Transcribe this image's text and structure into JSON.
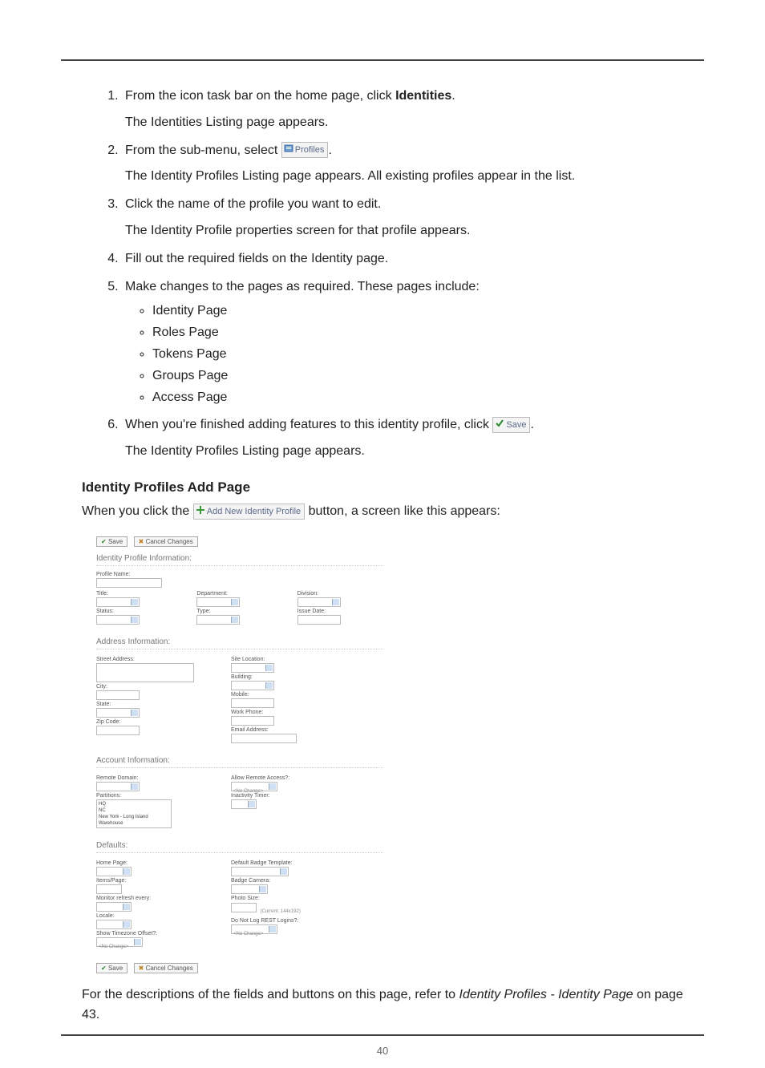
{
  "page_number": "40",
  "steps": {
    "s1a": "From the icon task bar on the home page, click ",
    "s1bold": "Identities",
    "s1b": ".",
    "s1sub": "The Identities Listing page appears.",
    "s2a": "From the sub-menu, select ",
    "s2btn_label": "Profiles",
    "s2b": ".",
    "s2sub": "The Identity Profiles Listing page appears. All existing profiles appear in the list.",
    "s3": "Click the name of the profile you want to edit.",
    "s3sub": "The Identity Profile properties screen for that profile appears.",
    "s4": "Fill out the required fields on the Identity page.",
    "s5": "Make changes to the pages as required. These pages include:",
    "bullets": {
      "b1": "Identity Page",
      "b2": "Roles Page",
      "b3": "Tokens Page",
      "b4": "Groups Page",
      "b5": "Access Page"
    },
    "s6a": "When you're finished adding features to this identity profile, click ",
    "s6btn_label": "Save",
    "s6b": ".",
    "s6sub": "The Identity Profiles Listing page appears."
  },
  "heading2": "Identity Profiles Add Page",
  "intro2a": "When you click the ",
  "intro2btn": "Add New Identity Profile",
  "intro2b": " button, a screen like this appears:",
  "fig": {
    "toolbar_save": "Save",
    "toolbar_cancel": "Cancel Changes",
    "sec_profile": "Identity Profile Information:",
    "profile_name": "Profile Name:",
    "title": "Title:",
    "department": "Department:",
    "division": "Division:",
    "status": "Status:",
    "type": "Type:",
    "issue_date": "Issue Date:",
    "sec_address": "Address Information:",
    "street": "Street Address:",
    "city": "City:",
    "state": "State:",
    "zip": "Zip Code:",
    "site_location": "Site Location:",
    "building": "Building:",
    "mobile": "Mobile:",
    "work_phone": "Work Phone:",
    "email": "Email Address:",
    "sec_account": "Account Information:",
    "remote_domain": "Remote Domain:",
    "partitions": "Partitions:",
    "part_opt1": "HQ",
    "part_opt2": "NC",
    "part_opt3": "New York - Long Island Warehouse",
    "allow_remote": "Allow Remote Access?:",
    "no_change": "<No Change>",
    "inactivity_timer": "Inactivity Timer:",
    "sec_defaults": "Defaults:",
    "home_page": "Home Page:",
    "items_page": "Items/Page:",
    "monitor_refresh": "Monitor refresh every:",
    "locale": "Locale:",
    "show_tz": "Show Timezone Offset?:",
    "default_badge": "Default Badge Template:",
    "badge_camera": "Badge Camera:",
    "photo_size": "Photo Size:",
    "photo_current": "(Current: 144x192)",
    "do_not_log": "Do Not Log REST Logins?:"
  },
  "outro_a": "For the descriptions of the fields and buttons on this page, refer to ",
  "outro_italic": "Identity Profiles - Identity Page",
  "outro_b": " on page 43."
}
